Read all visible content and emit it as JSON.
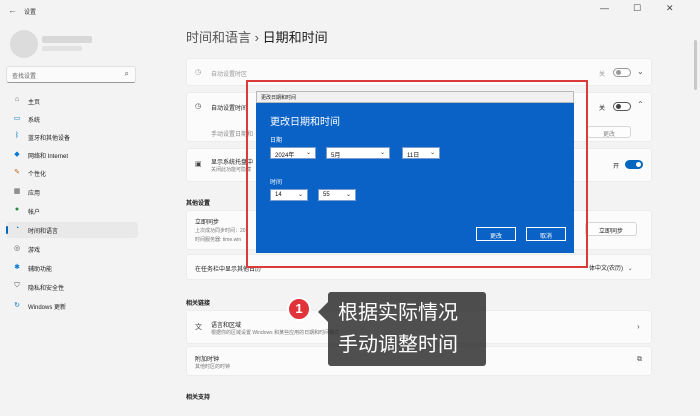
{
  "window": {
    "title": "设置",
    "controls": [
      "—",
      "☐",
      "✕"
    ]
  },
  "sidebar": {
    "search_placeholder": "查找设置",
    "items": [
      {
        "label": "主页",
        "icon": "home-icon"
      },
      {
        "label": "系统",
        "icon": "system-icon"
      },
      {
        "label": "蓝牙和其他设备",
        "icon": "bluetooth-icon"
      },
      {
        "label": "网络和 Internet",
        "icon": "network-icon"
      },
      {
        "label": "个性化",
        "icon": "brush-icon"
      },
      {
        "label": "应用",
        "icon": "apps-icon"
      },
      {
        "label": "帐户",
        "icon": "account-icon"
      },
      {
        "label": "时间和语言",
        "icon": "clock-globe-icon",
        "active": true
      },
      {
        "label": "游戏",
        "icon": "gamepad-icon"
      },
      {
        "label": "辅助功能",
        "icon": "accessibility-icon"
      },
      {
        "label": "隐私和安全性",
        "icon": "shield-icon"
      },
      {
        "label": "Windows 更新",
        "icon": "update-icon"
      }
    ]
  },
  "breadcrumb": {
    "parent": "时间和语言",
    "separator": "›",
    "current": "日期和时间"
  },
  "settings": {
    "auto_timezone_label": "自动设置时区",
    "auto_timezone_state": "关",
    "auto_time_label": "自动设置时间",
    "auto_time_state": "关",
    "manual_label": "手动设置日期和",
    "manual_button": "更改",
    "show_label": "显示系统托盘中",
    "show_sub": "关闭此功能可隐藏",
    "show_state": "开",
    "other_heading": "其他设置",
    "sync_label": "立即同步",
    "sync_sub1": "上次成功同步时间：20",
    "sync_sub2": "时间服务器: time.win",
    "sync_button": "立即同步",
    "taskbar_label": "在任务栏中显示其他日历",
    "taskbar_value": "体中文(农历)",
    "related_heading": "相关链接",
    "region_label": "语言和区域",
    "region_sub": "根据你的区域设置 Windows 和某些应用的日期和时间格式",
    "clock_label": "附加时钟",
    "clock_sub": "其他时区的时钟",
    "support_heading": "相关支持"
  },
  "dialog": {
    "window_title": "更改日期和时间",
    "heading": "更改日期和时间",
    "date_label": "日期",
    "year": "2024年",
    "month": "5月",
    "day": "11日",
    "time_label": "时间",
    "hour": "14",
    "minute": "55",
    "confirm": "更改",
    "cancel": "取消"
  },
  "annotation": {
    "number": "1",
    "line1": "根据实际情况",
    "line2": "手动调整时间"
  },
  "colors": {
    "accent": "#0067c0",
    "dialog_bg": "#0a62c6",
    "highlight_frame": "#d93b3b",
    "badge": "#e0333a"
  }
}
